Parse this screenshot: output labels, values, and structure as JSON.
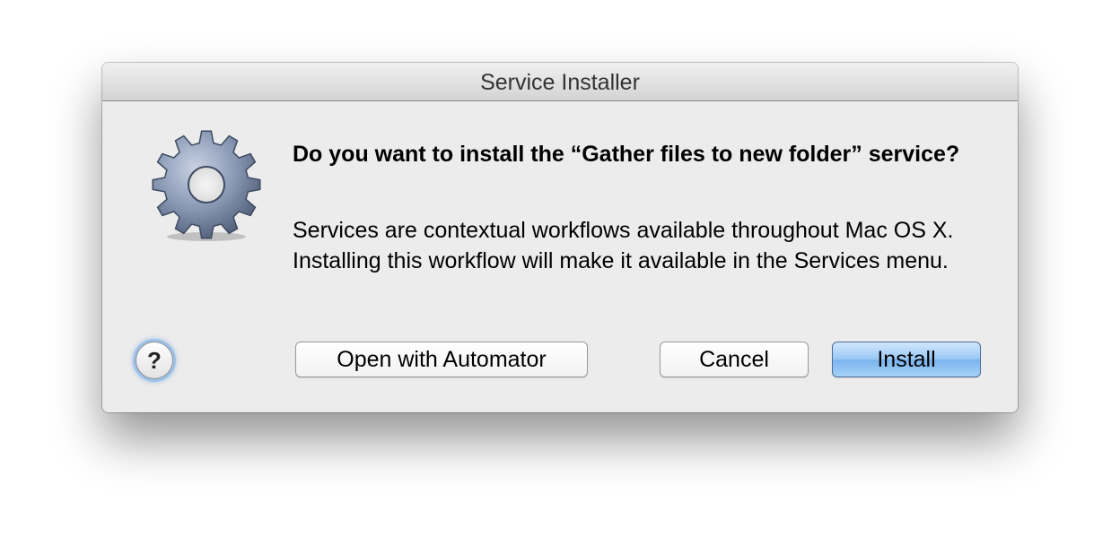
{
  "window": {
    "title": "Service Installer"
  },
  "dialog": {
    "icon": "gear-icon",
    "message": "Do you want to install the “Gather files to new folder” service?",
    "informative_text": "Services are contextual workflows available throughout Mac OS X. Installing this workflow will make it available in the Services menu."
  },
  "buttons": {
    "help_label": "?",
    "open_with_automator_label": "Open with Automator",
    "cancel_label": "Cancel",
    "install_label": "Install"
  },
  "colors": {
    "default_button": "#8fc2f4",
    "window_background": "#ececec",
    "gear": "#6f7f9c"
  }
}
